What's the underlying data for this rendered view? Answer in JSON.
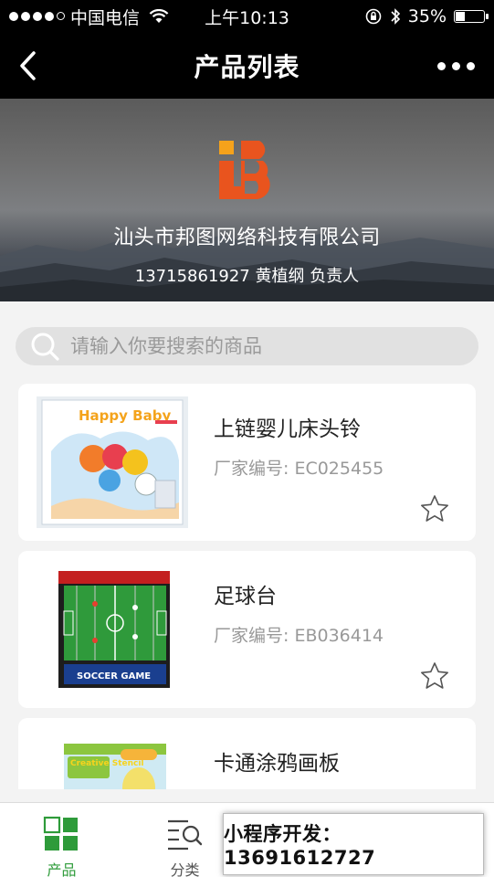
{
  "status_bar": {
    "carrier": "中国电信",
    "time": "上午10:13",
    "battery": "35%",
    "battery_level": 0.35
  },
  "nav": {
    "title": "产品列表"
  },
  "banner": {
    "company_name": "汕头市邦图网络科技有限公司",
    "contact": "13715861927 黄植纲 负责人",
    "logo_colors": {
      "orange": "#f5a21b",
      "red": "#e9541e"
    }
  },
  "search": {
    "placeholder": "请输入你要搜索的商品"
  },
  "products": [
    {
      "name": "上链婴儿床头铃",
      "code": "厂家编号: EC025455",
      "favorited": false,
      "image_text": "Happy Baby"
    },
    {
      "name": "足球台",
      "code": "厂家编号: EB036414",
      "favorited": false,
      "image_text": "SOCCER GAME"
    },
    {
      "name": "卡通涂鸦画板",
      "code": "",
      "favorited": false,
      "image_text": "Creative Stencil"
    }
  ],
  "tab_bar": {
    "tabs": [
      {
        "label": "产品",
        "icon": "grid-icon",
        "active": true
      },
      {
        "label": "分类",
        "icon": "category-search-icon",
        "active": false
      }
    ]
  },
  "promo": {
    "text": "小程序开发：13691612727"
  },
  "colors": {
    "accent_green": "#2e9b3a",
    "nav_background": "#000000",
    "page_background": "#f3f3f3"
  }
}
